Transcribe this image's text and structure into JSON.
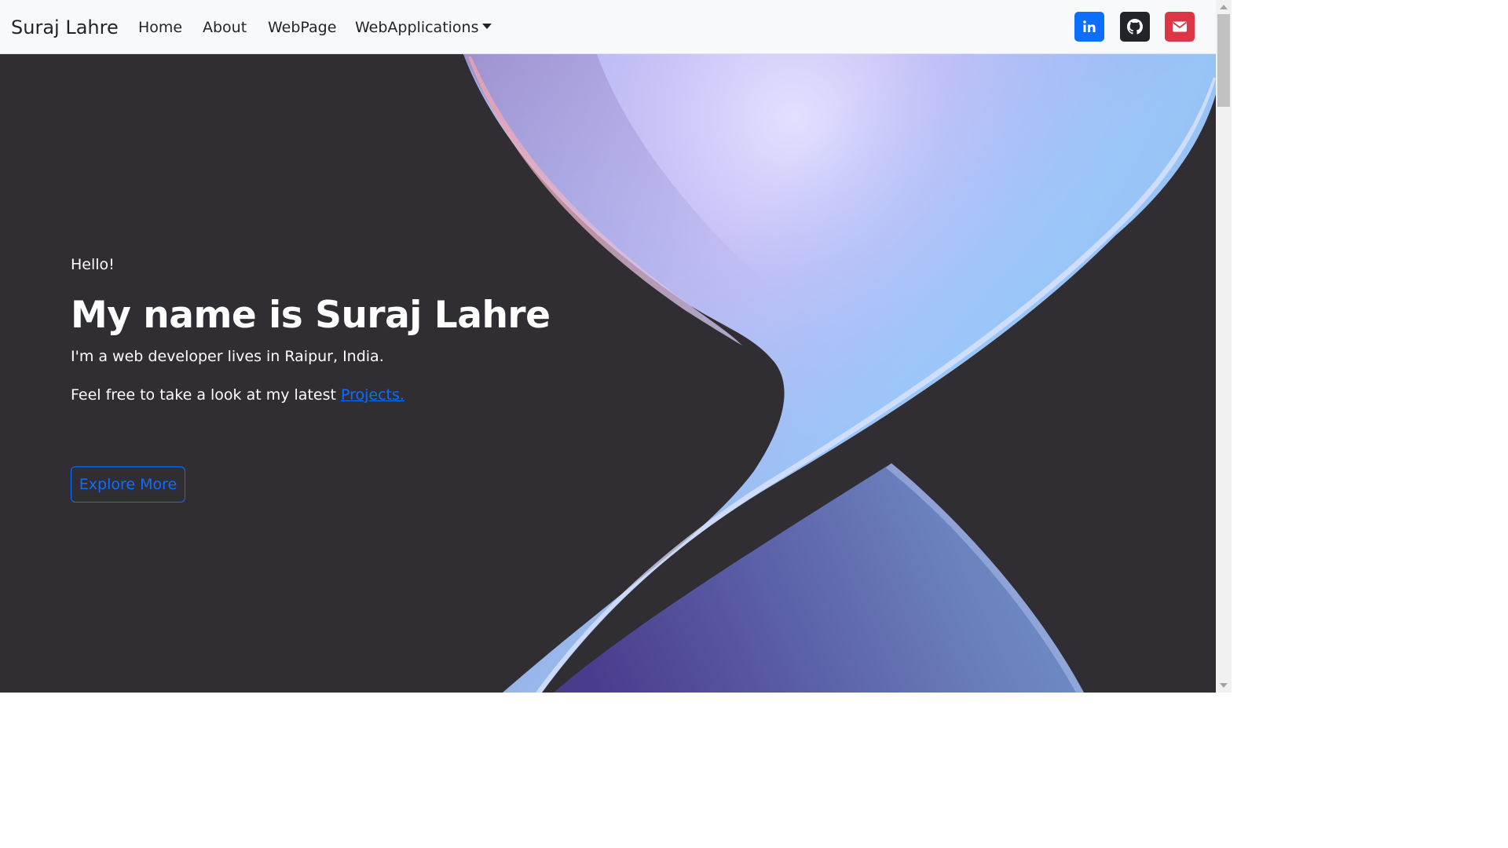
{
  "navbar": {
    "brand": "Suraj Lahre",
    "items": [
      {
        "label": "Home"
      },
      {
        "label": "About"
      },
      {
        "label": "WebPage"
      },
      {
        "label": "WebApplications"
      }
    ],
    "social": [
      {
        "name": "linkedin-icon",
        "color": "#0d6efd"
      },
      {
        "name": "github-icon",
        "color": "#212529"
      },
      {
        "name": "mail-icon",
        "color": "#dc3545"
      }
    ]
  },
  "hero": {
    "greeting": "Hello!",
    "headline": "My name is Suraj Lahre",
    "subline": "I'm a web developer lives in Raipur, India.",
    "projects_prefix": "Feel free to take a look at my latest ",
    "projects_link": "Projects.",
    "button_label": "Explore More"
  },
  "colors": {
    "background": "#312e33",
    "accent": "#0d6efd",
    "navbar": "#f8f9fa"
  }
}
